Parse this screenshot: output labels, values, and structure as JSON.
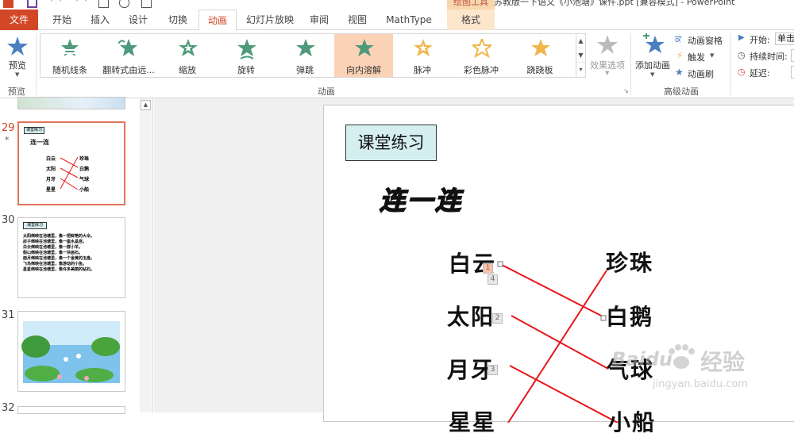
{
  "titlebar": {
    "context_tab_title": "绘图工具",
    "document_title": "苏教版一下语文《小池塘》课件.ppt [兼容模式] - PowerPoint"
  },
  "tabs": [
    "文件",
    "开始",
    "插入",
    "设计",
    "切换",
    "动画",
    "幻灯片放映",
    "审阅",
    "视图",
    "MathType",
    "格式"
  ],
  "active_tab": "动画",
  "ribbon": {
    "preview": {
      "label": "预览",
      "group": "预览"
    },
    "animations": [
      "随机线条",
      "翻转式由远...",
      "缩放",
      "旋转",
      "弹跳",
      "向内溶解",
      "脉冲",
      "彩色脉冲",
      "跷跷板"
    ],
    "selected_animation": "向内溶解",
    "effect_options": "效果选项",
    "animation_group": "动画",
    "advanced": {
      "add_animation": "添加动画",
      "animation_pane": "动画窗格",
      "trigger": "触发",
      "animation_painter": "动画刷",
      "group": "高级动画"
    },
    "timing": {
      "start_label": "开始:",
      "start_value": "单击",
      "duration_label": "持续时间:",
      "delay_label": "延迟:"
    }
  },
  "thumbnails": [
    {
      "num": "29",
      "selected": true,
      "title": "课堂练习",
      "heading": "连一连",
      "left": [
        "白云",
        "太阳",
        "月牙",
        "星星"
      ],
      "right": [
        "珍珠",
        "白鹅",
        "气球",
        "小船"
      ]
    },
    {
      "num": "30",
      "selected": false,
      "title": "课堂练习",
      "lines": [
        "太阳倒映在池塘里，像一把鲜艳的大伞。",
        "房子倒映在池塘里，像一座水晶宫。",
        "白云倒映在池塘里，像一群小羊。",
        "假山倒映在池塘里，像一块画石。",
        "面月倒映在池塘里，像一个金黄的玉盘。",
        "飞鸟倒映在池塘里，像游动的小鱼。",
        "星星倒映在池塘里，像许多美丽的钻石。"
      ]
    },
    {
      "num": "31",
      "selected": false
    },
    {
      "num": "32",
      "selected": false
    }
  ],
  "slide": {
    "title": "课堂练习",
    "heading": "连一连",
    "left_words": [
      "白云",
      "太阳",
      "月牙",
      "星星"
    ],
    "right_words": [
      "珍珠",
      "白鹅",
      "气球",
      "小船"
    ],
    "anim_tags": [
      "1",
      "4",
      "2",
      "3"
    ]
  },
  "watermark": {
    "brand": "Baidu",
    "cn": "经验",
    "url": "jingyan.baidu.com"
  },
  "colors": {
    "accent": "#d24726",
    "selected_anim": "#fcd2b7",
    "line": "#e8161b",
    "title_box": "#d5eef0",
    "heading": "#ffe200"
  }
}
